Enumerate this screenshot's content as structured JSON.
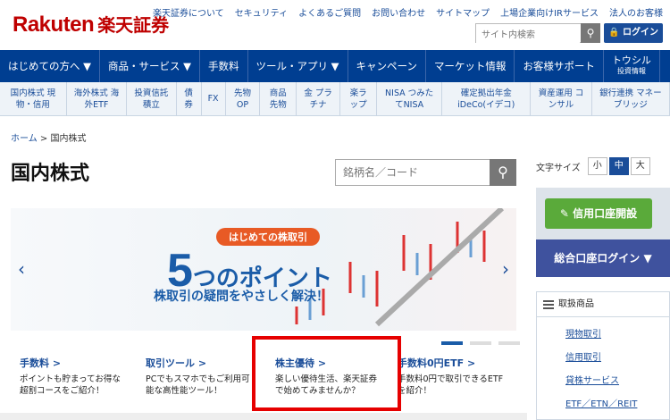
{
  "header": {
    "logo_brand": "Rakuten",
    "logo_suffix": "楽天証券",
    "links": [
      "楽天証券について",
      "セキュリティ",
      "よくあるご質問",
      "お問い合わせ",
      "サイトマップ",
      "上場企業向けIRサービス",
      "法人のお客様"
    ],
    "site_search_placeholder": "サイト内検索",
    "login_label": "ログイン"
  },
  "nav": {
    "items": [
      "はじめての方へ ▼",
      "商品・サービス ▼",
      "手数料",
      "ツール・アプリ ▼",
      "キャンペーン",
      "マーケット情報",
      "お客様サポート"
    ],
    "toshiru": "トウシル",
    "toshiru_sub": "投資情報"
  },
  "subnav": [
    "国内株式 現物・信用",
    "海外株式 海外ETF",
    "投資信託 積立",
    "債券",
    "FX",
    "先物 OP",
    "商品先物",
    "金 プラチナ",
    "楽ラップ",
    "NISA つみたてNISA",
    "確定拠出年金 iDeCo(イデコ)",
    "資産運用 コンサル",
    "銀行連携 マネーブリッジ"
  ],
  "breadcrumb": {
    "home": "ホーム",
    "sep": ">",
    "current": "国内株式"
  },
  "page_title": "国内株式",
  "stock_search_placeholder": "銘柄名／コード",
  "banner": {
    "pill": "はじめての株取引",
    "big_num": "5",
    "big_text": "つのポイント",
    "sub": "株取引の疑問をやさしく解決！",
    "prev": "‹",
    "next": "›"
  },
  "cards": [
    {
      "title": "手数料 >",
      "desc": "ポイントも貯まってお得な超割コースをご紹介！"
    },
    {
      "title": "取引ツール >",
      "desc": "PCでもスマホでもご利用可能な高性能ツール！"
    },
    {
      "title": "株主優待 >",
      "desc": "楽しい優待生活、楽天証券で始めてみませんか？"
    },
    {
      "title": "手数料0円ETF >",
      "desc": "手数料0円で取引できるETFを紹介！"
    }
  ],
  "rail": {
    "font_size_label": "文字サイズ",
    "sizes": [
      "小",
      "中",
      "大"
    ],
    "open_account": "信用口座開設",
    "login": "総合口座ログイン ▼",
    "products_header": "取扱商品",
    "products": [
      "現物取引",
      "信用取引",
      "貸株サービス",
      "ETF／ETN／REIT"
    ]
  }
}
